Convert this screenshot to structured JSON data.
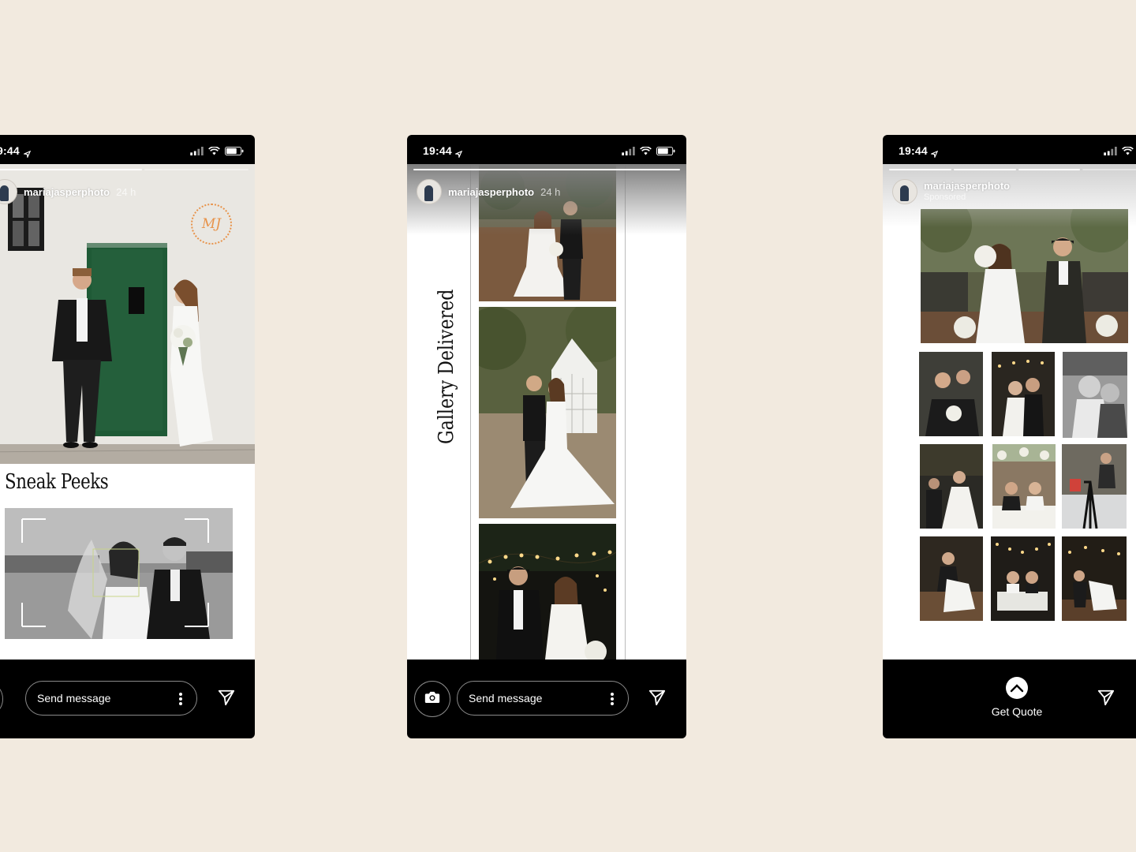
{
  "phones": [
    {
      "time": "9:44",
      "username": "mariajasperphoto",
      "age": "24 h",
      "heading": "Sneak Peeks",
      "message_placeholder": "Send message",
      "logo_monogram": "MJ"
    },
    {
      "time": "19:44",
      "username": "mariajasperphoto",
      "age": "24 h",
      "heading": "Gallery Delivered",
      "message_placeholder": "Send message"
    },
    {
      "time": "19:44",
      "username": "mariajasperphoto",
      "sponsored_label": "Sponsored",
      "cta_label": "Get Quote"
    }
  ],
  "icons": {
    "status": [
      "signal-icon",
      "wifi-icon",
      "battery-icon",
      "location-arrow-icon"
    ],
    "bottom": [
      "camera-icon",
      "more-options-icon",
      "send-icon",
      "chevron-up-icon"
    ]
  },
  "colors": {
    "page_background": "#f2eadf",
    "phone_frame": "#000000",
    "door_green": "#1f5a36",
    "logo_orange": "#e8934a"
  }
}
